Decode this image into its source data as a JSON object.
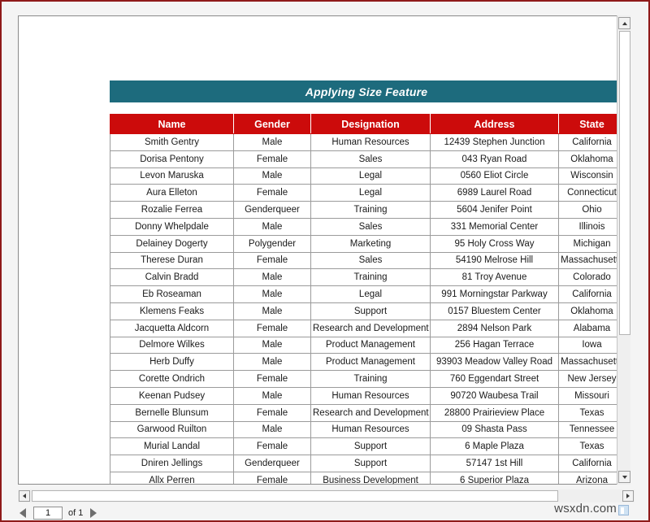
{
  "window": {
    "border_color": "#8f1a1a"
  },
  "report": {
    "title": "Applying Size Feature",
    "title_bg": "#1d6b7d",
    "header_bg": "#cc0b0b",
    "columns": [
      "Name",
      "Gender",
      "Designation",
      "Address",
      "State"
    ],
    "rows": [
      [
        "Smith Gentry",
        "Male",
        "Human Resources",
        "12439 Stephen Junction",
        "California"
      ],
      [
        "Dorisa Pentony",
        "Female",
        "Sales",
        "043 Ryan Road",
        "Oklahoma"
      ],
      [
        "Levon Maruska",
        "Male",
        "Legal",
        "0560 Eliot Circle",
        "Wisconsin"
      ],
      [
        "Aura Elleton",
        "Female",
        "Legal",
        "6989 Laurel Road",
        "Connecticut"
      ],
      [
        "Rozalie Ferrea",
        "Genderqueer",
        "Training",
        "5604 Jenifer Point",
        "Ohio"
      ],
      [
        "Donny Whelpdale",
        "Male",
        "Sales",
        "331 Memorial Center",
        "Illinois"
      ],
      [
        "Delainey Dogerty",
        "Polygender",
        "Marketing",
        "95 Holy Cross Way",
        "Michigan"
      ],
      [
        "Therese Duran",
        "Female",
        "Sales",
        "54190 Melrose Hill",
        "Massachusetts"
      ],
      [
        "Calvin Bradd",
        "Male",
        "Training",
        "81 Troy Avenue",
        "Colorado"
      ],
      [
        "Eb Roseaman",
        "Male",
        "Legal",
        "991 Morningstar Parkway",
        "California"
      ],
      [
        "Klemens Feaks",
        "Male",
        "Support",
        "0157 Bluestem Center",
        "Oklahoma"
      ],
      [
        "Jacquetta Aldcorn",
        "Female",
        "Research and Development",
        "2894 Nelson Park",
        "Alabama"
      ],
      [
        "Delmore Wilkes",
        "Male",
        "Product Management",
        "256 Hagan Terrace",
        "Iowa"
      ],
      [
        "Herb Duffy",
        "Male",
        "Product Management",
        "93903 Meadow Valley Road",
        "Massachusetts"
      ],
      [
        "Corette Ondrich",
        "Female",
        "Training",
        "760 Eggendart Street",
        "New Jersey"
      ],
      [
        "Keenan Pudsey",
        "Male",
        "Human Resources",
        "90720 Waubesa Trail",
        "Missouri"
      ],
      [
        "Bernelle Blunsum",
        "Female",
        "Research and Development",
        "28800 Prairieview Place",
        "Texas"
      ],
      [
        "Garwood Ruilton",
        "Male",
        "Human Resources",
        "09 Shasta Pass",
        "Tennessee"
      ],
      [
        "Murial Landal",
        "Female",
        "Support",
        "6 Maple Plaza",
        "Texas"
      ],
      [
        "Dniren Jellings",
        "Genderqueer",
        "Support",
        "57147 1st Hill",
        "California"
      ],
      [
        "Allx Perren",
        "Female",
        "Business Development",
        "6 Superior Plaza",
        "Arizona"
      ]
    ]
  },
  "pagination": {
    "current_page": "1",
    "total_label": "of 1",
    "prev_icon": "triangle-left-icon",
    "next_icon": "triangle-right-icon"
  },
  "scrollbars": {
    "vertical_up_icon": "triangle-up-icon",
    "vertical_down_icon": "triangle-down-icon",
    "horizontal_left_icon": "triangle-left-icon",
    "horizontal_right_icon": "triangle-right-icon"
  },
  "watermark": {
    "text": "wsxdn.com",
    "glyph": "book-icon"
  }
}
